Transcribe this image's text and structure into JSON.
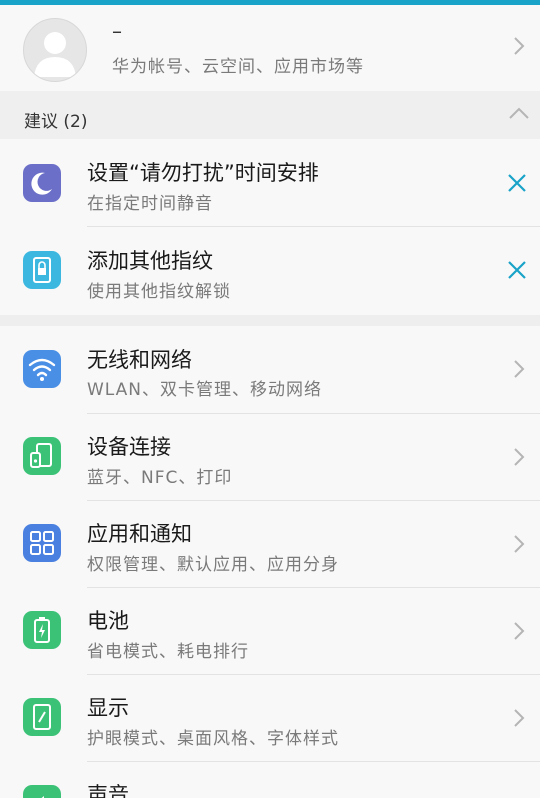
{
  "account": {
    "name": "–",
    "subtitle": "华为帐号、云空间、应用市场等"
  },
  "suggestions": {
    "header": "建议 (2)",
    "items": [
      {
        "title": "设置“请勿打扰”时间安排",
        "subtitle": "在指定时间静音",
        "icon": "moon-icon",
        "color": "#6b6fc8"
      },
      {
        "title": "添加其他指纹",
        "subtitle": "使用其他指纹解锁",
        "icon": "fingerprint-lock-icon",
        "color": "#3cb8e0"
      }
    ]
  },
  "settings": [
    {
      "title": "无线和网络",
      "subtitle": "WLAN、双卡管理、移动网络",
      "icon": "wifi-icon",
      "color": "#4a8fe6"
    },
    {
      "title": "设备连接",
      "subtitle": "蓝牙、NFC、打印",
      "icon": "device-connection-icon",
      "color": "#3cc277"
    },
    {
      "title": "应用和通知",
      "subtitle": "权限管理、默认应用、应用分身",
      "icon": "apps-grid-icon",
      "color": "#4a80e0"
    },
    {
      "title": "电池",
      "subtitle": "省电模式、耗电排行",
      "icon": "battery-icon",
      "color": "#3cc277"
    },
    {
      "title": "显示",
      "subtitle": "护眼模式、桌面风格、字体样式",
      "icon": "display-icon",
      "color": "#3cc277"
    },
    {
      "title": "声音",
      "subtitle": "",
      "icon": "sound-icon",
      "color": "#3cc277"
    }
  ],
  "accent": "#1aa3c8"
}
